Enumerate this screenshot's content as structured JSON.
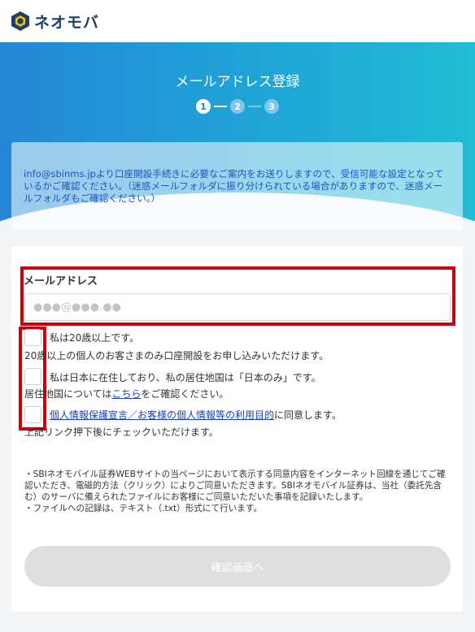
{
  "brand": {
    "name": "ネオモバ"
  },
  "hero": {
    "title": "メールアドレス登録",
    "steps": [
      "1",
      "2",
      "3"
    ]
  },
  "notice": {
    "text": "info@sbinms.jpより口座開設手続きに必要なご案内をお送りしますので、受信可能な設定となっているかご確認ください。（迷惑メールフォルダに振り分けられている場合がありますので、迷惑メールフォルダもご確認ください。）"
  },
  "form": {
    "email_label": "メールアドレス",
    "email_placeholder": "●●●@●●●.●●",
    "email_value": "",
    "checks": [
      {
        "label": "私は20歳以上です。",
        "note": "20歳以上の個人のお客さまのみ口座開設をお申し込みいただけます。",
        "checked": false
      },
      {
        "label": "私は日本に在住しており、私の居住地国は「日本のみ」です。",
        "note_prefix": "居住地国については",
        "note_link": "こちら",
        "note_suffix": "をご確認ください。",
        "checked": false
      },
      {
        "link": "個人情報保護宣言／お客様の個人情報等の利用目的",
        "label_suffix": "に同意します。",
        "note": "上記リンク押下後にチェックいただけます。",
        "checked": false
      }
    ],
    "disclaimer_1": "・SBIネオモバイル証券WEBサイトの当ページにおいて表示する同意内容をインターネット回線を通じてご確認いただき、電磁的方法（クリック）によりご同意いただきます。SBIネオモバイル証券は、当社（委託先含む）のサーバに備えられたファイルにお客様にご同意いただいた事項を記録いたします。",
    "disclaimer_2": "・ファイルへの記録は、テキスト（.txt）形式にて行います。",
    "submit_label": "確認画面へ"
  },
  "colors": {
    "brand_navy": "#1e3f66",
    "hero_start": "#2487d6",
    "hero_end": "#21bcd5",
    "notice_text": "#1b55c4",
    "highlight_red": "#c8000b",
    "button_disabled": "#dedede"
  }
}
